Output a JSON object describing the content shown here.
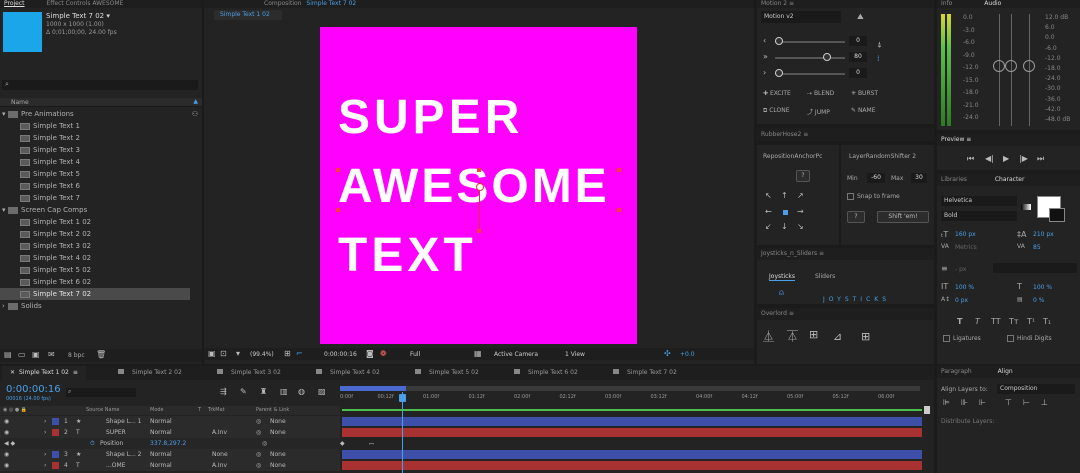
{
  "project": {
    "tab": "Project",
    "tab2": "Effect Controls  AWESOME",
    "item_name": "Simple Text 7 02 ▾",
    "item_info1": "1000 x 1000 (1.00)",
    "item_info2": "Δ 0;01;00;00, 24.00 fps",
    "column_name": "Name",
    "bpc": "8 bpc",
    "folders": [
      {
        "name": "Pre Animations",
        "items": [
          "Simple Text 1",
          "Simple Text 2",
          "Simple Text 3",
          "Simple Text 4",
          "Simple Text 5",
          "Simple Text 6",
          "Simple Text 7"
        ]
      },
      {
        "name": "Screen Cap Comps",
        "items": [
          "Simple Text 1 02",
          "Simple Text 2 02",
          "Simple Text 3 02",
          "Simple Text 4 02",
          "Simple Text 5 02",
          "Simple Text 6 02",
          "Simple Text 7 02"
        ]
      },
      {
        "name": "Solids",
        "items": []
      }
    ]
  },
  "composition": {
    "tab_prefix": "Composition",
    "tab_name": "Simple Text 7 02",
    "sub_tab": "Simple Text 1 02",
    "text_lines": [
      "SUPER",
      "AWESOME",
      "TEXT"
    ],
    "canvas_color": "#ff00ff",
    "zoom": "(99.4%)",
    "timecode": "0:00:00:16",
    "resolution": "Full",
    "camera": "Active Camera",
    "view": "1 View",
    "exposure": "+0.0"
  },
  "motion": {
    "title": "Motion 2",
    "preset": "Motion v2",
    "values": [
      "0",
      "80",
      "0"
    ],
    "actions": [
      "EXCITE",
      "BLEND",
      "BURST",
      "CLONE",
      "JUMP",
      "NAME"
    ]
  },
  "rubberhose": {
    "title": "RubberHose2"
  },
  "reposition": {
    "title": "RepositionAnchorPc",
    "center_btn": "?"
  },
  "shifter": {
    "title": "LayerRandomShifter 2",
    "min_label": "Min",
    "min_val": "-60",
    "max_label": "Max",
    "max_val": "30",
    "snap": "Snap to frame",
    "help": "?",
    "shift_btn": "Shift 'em!"
  },
  "joysticks": {
    "title": "Joysticks_n_Sliders",
    "tab1": "Joysticks",
    "tab2": "Sliders",
    "banner": "JOYSTICKS"
  },
  "overlord": {
    "title": "Overlord"
  },
  "info_audio": {
    "tab1": "Info",
    "tab2": "Audio",
    "db_left": [
      "0.0",
      "-3.0",
      "-6.0",
      "-9.0",
      "-12.0",
      "-15.0",
      "-18.0",
      "-21.0",
      "-24.0"
    ],
    "db_right": [
      "12.0 dB",
      "6.0",
      "0.0",
      "-6.0",
      "-12.0",
      "-18.0",
      "-24.0",
      "-30.0",
      "-36.0",
      "-42.0",
      "-48.0 dB"
    ]
  },
  "preview": {
    "title": "Preview"
  },
  "character": {
    "tab1": "Libraries",
    "tab2": "Character",
    "font": "Helvetica",
    "style": "Bold",
    "font_size": "160 px",
    "leading": "210 px",
    "kerning": "Metrics",
    "tracking": "85",
    "stroke": "- px",
    "vscale": "100 %",
    "hscale": "100 %",
    "baseline": "0 px",
    "tsume": "0 %",
    "styles": [
      "T",
      "T",
      "TT",
      "Tт",
      "T¹",
      "T₁"
    ],
    "ligatures": "Ligatures",
    "hindi": "Hindi Digits"
  },
  "align": {
    "tab1": "Paragraph",
    "tab2": "Align",
    "align_to_label": "Align Layers to:",
    "align_to_value": "Composition",
    "distribute": "Distribute Layers:"
  },
  "timeline": {
    "tabs": [
      "Simple Text 1 02",
      "Simple Text 2 02",
      "Simple Text 3 02",
      "Simple Text 4 02",
      "Simple Text 5 02",
      "Simple Text 6 02",
      "Simple Text 7 02"
    ],
    "timecode": "0:00:00:16",
    "fps": "00016 (24.00 fps)",
    "columns": [
      "Source Name",
      "Mode",
      "T",
      "TrkMat",
      "Parent & Link"
    ],
    "ruler": [
      "0:00f",
      "00:12f",
      "01:00f",
      "01:12f",
      "02:00f",
      "02:12f",
      "03:00f",
      "03:12f",
      "04:00f",
      "04:12f",
      "05:00f",
      "05:12f",
      "06:00f"
    ],
    "layers": [
      {
        "num": "1",
        "name": "Shape L... 1",
        "mode": "Normal",
        "trkmat": "",
        "parent": "None",
        "color": "#3d4fa8"
      },
      {
        "num": "2",
        "name": "SUPER",
        "mode": "Normal",
        "trkmat": "A.Inv",
        "parent": "None",
        "color": "#a83232"
      },
      {
        "num": "",
        "name": "Position",
        "mode": "337.8,297.2",
        "trkmat": "",
        "parent": "",
        "color": ""
      },
      {
        "num": "3",
        "name": "Shape L... 2",
        "mode": "Normal",
        "trkmat": "None",
        "parent": "None",
        "color": "#3d4fa8"
      },
      {
        "num": "4",
        "name": "...OME",
        "mode": "Normal",
        "trkmat": "A.Inv",
        "parent": "None",
        "color": "#a83232"
      }
    ]
  }
}
